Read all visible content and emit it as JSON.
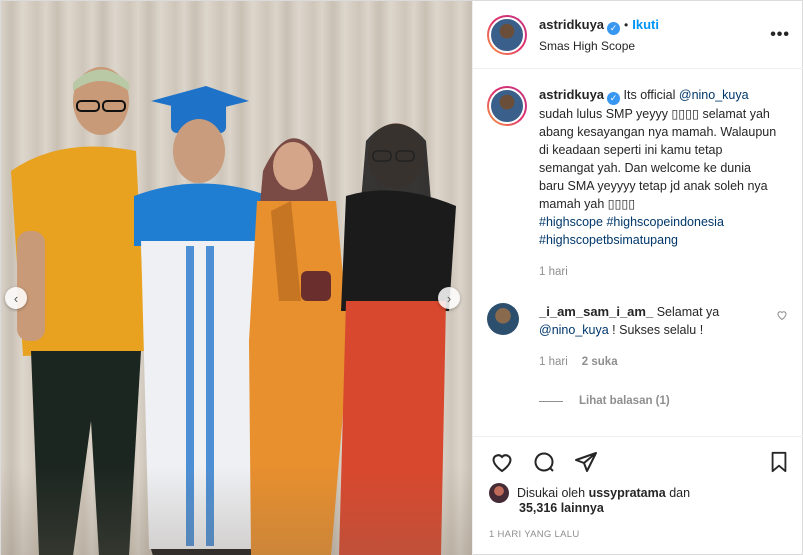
{
  "post": {
    "image_alt": "Foto keluarga wisuda",
    "arrows": {
      "prev": "‹",
      "next": "›"
    }
  },
  "header": {
    "username": "astridkuya",
    "verified_mark": "✓",
    "separator": "•",
    "follow_label": "Ikuti",
    "location": "Smas High Scope",
    "more_label": "•••"
  },
  "caption": {
    "username": "astridkuya",
    "verified_mark": "✓",
    "text_part1": "Its official ",
    "mention": "@nino_kuya",
    "text_part2": "sudah lulus SMP yeyyy ▯▯▯▯ selamat yah abang kesayangan nya mamah. Walaupun di keadaan seperti ini kamu tetap semangat yah. Dan welcome ke dunia baru SMA yeyyyy tetap jd anak soleh nya mamah yah ▯▯▯▯",
    "hashtags": [
      "#highscope",
      "#highscopeindonesia",
      "#highscopetbsimatupang"
    ],
    "time": "1 hari"
  },
  "comment": {
    "username": "_i_am_sam_i_am_",
    "text_part1": "Selamat ya",
    "mention": "@nino_kuya",
    "text_part2": "! Sukses selalu !",
    "time": "1 hari",
    "likes": "2 suka",
    "view_replies": "Lihat balasan (1)"
  },
  "actions": {
    "liked_by_prefix": "Disukai oleh",
    "liked_by_user": "ussypratama",
    "liked_by_and": "dan",
    "others_count": "35,316 lainnya",
    "date": "1 HARI YANG LALU"
  },
  "colors": {
    "link": "#00376b",
    "follow": "#0095f6",
    "muted": "#8e8e8e",
    "verified": "#3897f0"
  }
}
